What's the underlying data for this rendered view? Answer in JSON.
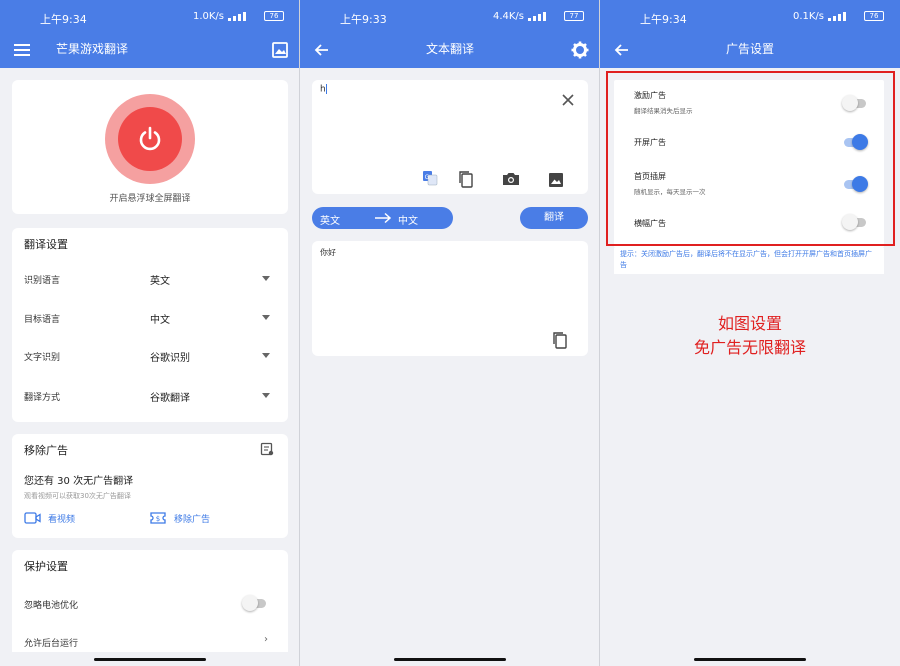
{
  "status": [
    {
      "time": "上午9:34",
      "speed": "1.0K/s",
      "battery": "76"
    },
    {
      "time": "上午9:33",
      "speed": "4.4K/s",
      "battery": "77"
    },
    {
      "time": "上午9:34",
      "speed": "0.1K/s",
      "battery": "76"
    }
  ],
  "panel1": {
    "app_title": "芒果游戏翻译",
    "power_label": "开启悬浮球全屏翻译",
    "settings": {
      "title": "翻译设置",
      "rows": [
        {
          "label": "识别语言",
          "value": "英文"
        },
        {
          "label": "目标语言",
          "value": "中文"
        },
        {
          "label": "文字识别",
          "value": "谷歌识别"
        },
        {
          "label": "翻译方式",
          "value": "谷歌翻译"
        }
      ]
    },
    "ads": {
      "title": "移除广告",
      "remaining": "您还有 30 次无广告翻译",
      "hint": "观看视频可以获取30次无广告翻译",
      "watch_label": "看视频",
      "remove_label": "移除广告"
    },
    "protect": {
      "title": "保护设置",
      "battery_label": "忽略电池优化",
      "next_label": "允许后台运行"
    }
  },
  "panel2": {
    "title": "文本翻译",
    "input_value": "h",
    "source_lang": "英文",
    "target_lang": "中文",
    "translate_label": "翻译",
    "output_value": "你好"
  },
  "panel3": {
    "title": "广告设置",
    "items": [
      {
        "title": "激励广告",
        "sub": "翻译结果消失后显示",
        "on": false
      },
      {
        "title": "开屏广告",
        "sub": "",
        "on": true
      },
      {
        "title": "首页插屏",
        "sub": "随机显示，每天显示一次",
        "on": true
      },
      {
        "title": "横幅广告",
        "sub": "",
        "on": false
      }
    ],
    "tip": "提示：关闭激励广告后，翻译后将不在显示广告，但会打开开屏广告和首页插屏广告",
    "annotation_line1": "如图设置",
    "annotation_line2": "免广告无限翻译"
  },
  "colors": {
    "primary": "#4a7de6",
    "accent": "#3d7ae6",
    "power": "#f04a4a",
    "annotation": "#e02020"
  }
}
